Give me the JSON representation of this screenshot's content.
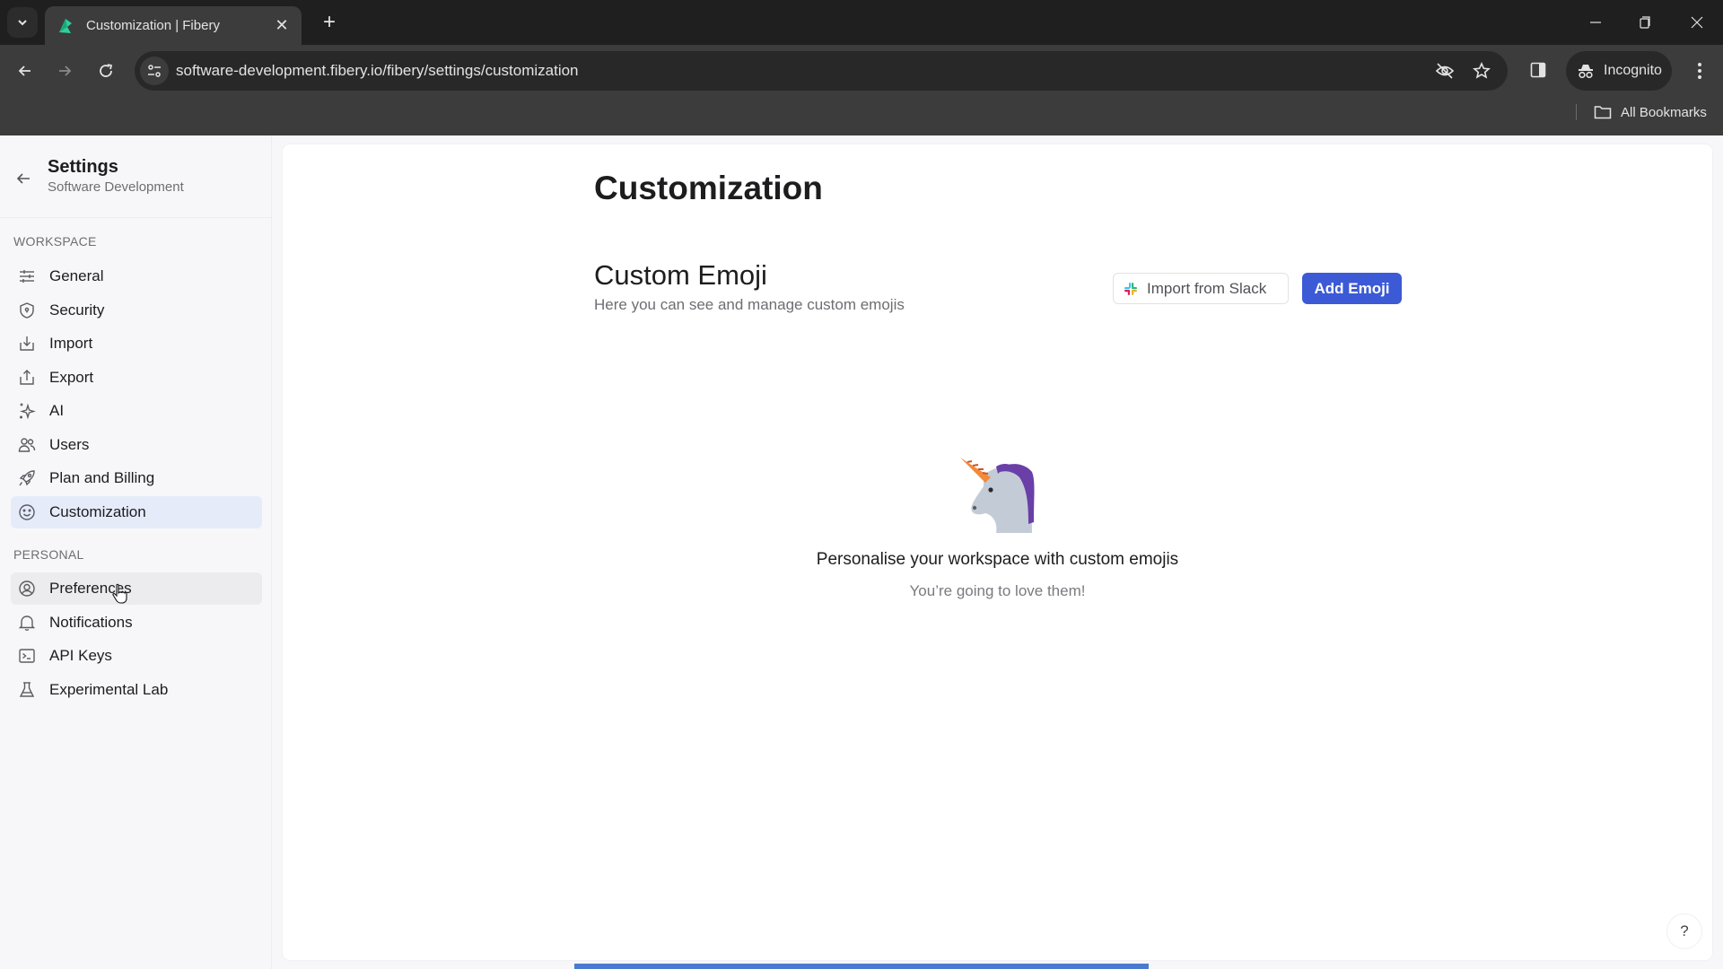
{
  "browser": {
    "tab_title": "Customization | Fibery",
    "url": "software-development.fibery.io/fibery/settings/customization",
    "incognito_label": "Incognito",
    "bookmarks_label": "All Bookmarks",
    "icons": {
      "tab_search": "chevron-down-icon",
      "favicon": "fibery-logo-icon",
      "tab_close": "close-icon",
      "new_tab": "plus-icon",
      "back": "arrow-left-icon",
      "forward": "arrow-right-icon",
      "reload": "reload-icon",
      "site_info": "tune-icon",
      "tracking": "eye-off-icon",
      "bookmark": "star-icon",
      "side_panel": "side-panel-icon",
      "incognito": "incognito-icon",
      "menu": "more-vertical-icon",
      "folder": "folder-icon"
    }
  },
  "sidebar": {
    "title": "Settings",
    "subtitle": "Software Development",
    "sections": [
      {
        "label": "WORKSPACE",
        "items": [
          {
            "label": "General",
            "icon": "sliders-icon"
          },
          {
            "label": "Security",
            "icon": "shield-icon"
          },
          {
            "label": "Import",
            "icon": "import-icon"
          },
          {
            "label": "Export",
            "icon": "export-icon"
          },
          {
            "label": "AI",
            "icon": "sparkles-icon"
          },
          {
            "label": "Users",
            "icon": "users-icon"
          },
          {
            "label": "Plan and Billing",
            "icon": "rocket-icon"
          },
          {
            "label": "Customization",
            "icon": "smile-icon",
            "active": true
          }
        ]
      },
      {
        "label": "PERSONAL",
        "items": [
          {
            "label": "Preferences",
            "icon": "user-circle-icon",
            "hovered": true
          },
          {
            "label": "Notifications",
            "icon": "bell-icon"
          },
          {
            "label": "API Keys",
            "icon": "terminal-icon"
          },
          {
            "label": "Experimental Lab",
            "icon": "flask-icon"
          }
        ]
      }
    ]
  },
  "main": {
    "page_title": "Customization",
    "section_title": "Custom Emoji",
    "section_subtitle": "Here you can see and manage custom emojis",
    "import_button": "Import from Slack",
    "add_button": "Add Emoji",
    "empty_state": {
      "illustration": "unicorn-icon",
      "title": "Personalise your workspace with custom emojis",
      "subtitle": "You’re going to love them!"
    },
    "help_label": "?"
  },
  "colors": {
    "accent": "#3c5ad6",
    "active_item_bg": "#e6ebfa"
  }
}
